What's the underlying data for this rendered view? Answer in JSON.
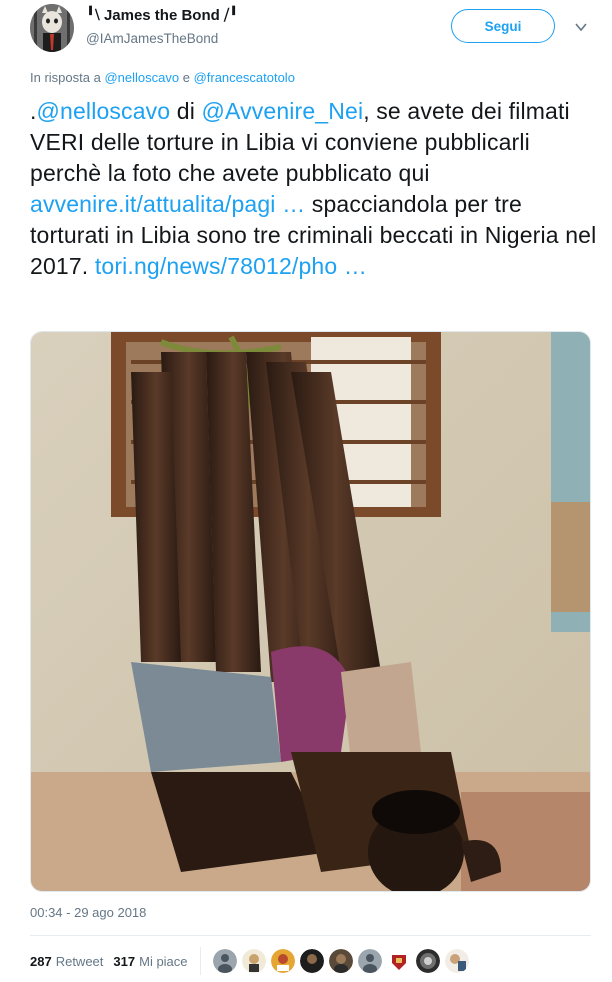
{
  "header": {
    "display_name": "╹⧵ James the Bond ⧸╹",
    "handle": "@IAmJamesTheBond",
    "follow_label": "Segui"
  },
  "reply": {
    "prefix": "In risposta a",
    "user1": "@nelloscavo",
    "conj": "e",
    "user2": "@francescatotolo"
  },
  "tweet": {
    "t1": ".",
    "m1": "@nelloscavo",
    "t2": " di ",
    "m2": "@Avvenire_Nei",
    "t3": ", se avete dei filmati VERI delle torture in Libia vi conviene pubblicarli perchè la foto che avete pubblicato qui ",
    "l1": "avvenire.it/attualita/pagi …",
    "t4": " spacciandola per tre torturati in Libia sono tre criminali beccati in Nigeria nel 2017. ",
    "l2": "tori.ng/news/78012/pho …"
  },
  "timestamp": "00:34 - 29 ago 2018",
  "stats": {
    "retweets_count": "287",
    "retweets_label": "Retweet",
    "likes_count": "317",
    "likes_label": "Mi piace"
  },
  "colors": {
    "accent": "#1da1f2",
    "muted": "#657786",
    "text": "#14171a"
  }
}
